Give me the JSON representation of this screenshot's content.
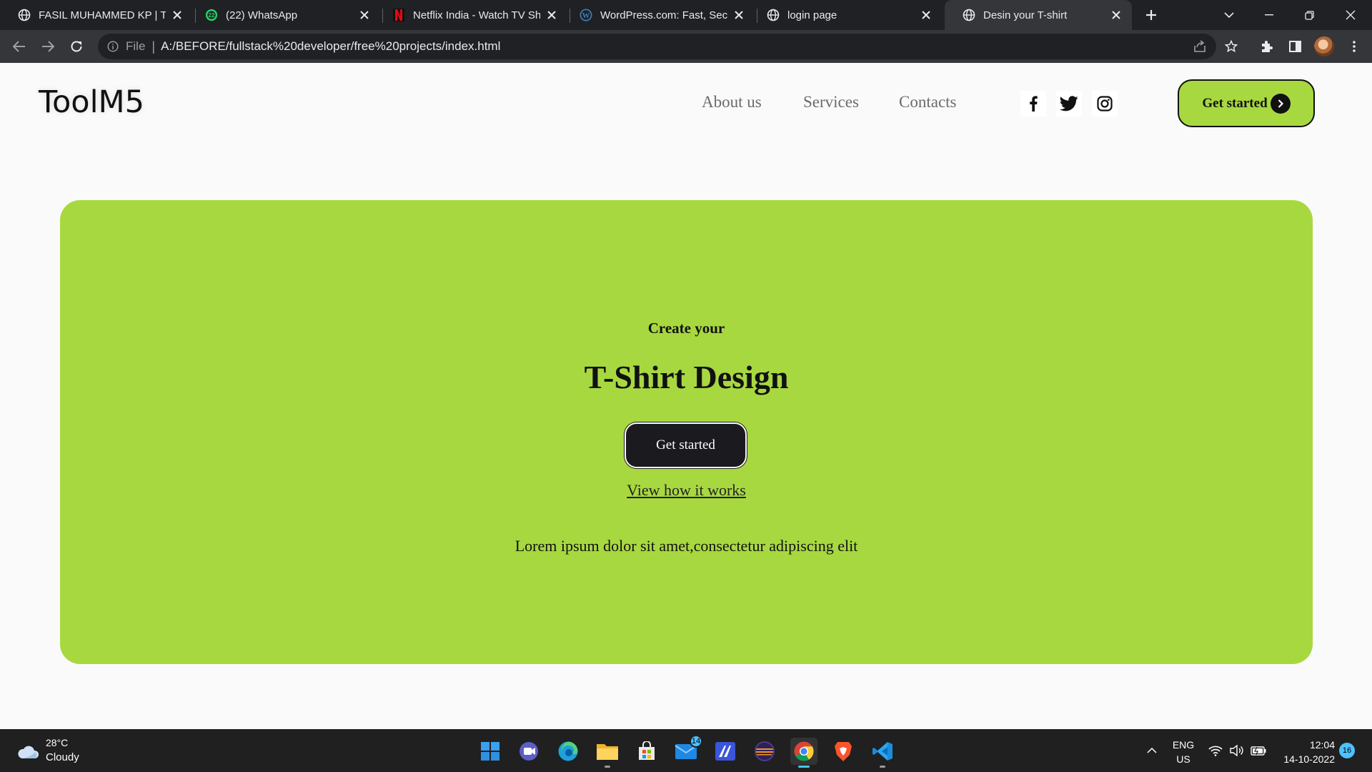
{
  "browser": {
    "tabs": [
      {
        "title": "FASIL MUHAMMED KP | TECH",
        "favicon": "globe-icon"
      },
      {
        "title": "(22) WhatsApp",
        "favicon": "whatsapp-icon",
        "badge": "22"
      },
      {
        "title": "Netflix India - Watch TV Shows",
        "favicon": "netflix-icon"
      },
      {
        "title": "WordPress.com: Fast, Secure",
        "favicon": "wordpress-icon"
      },
      {
        "title": "login page",
        "favicon": "globe-icon"
      },
      {
        "title": "Desin your T-shirt",
        "favicon": "globe-icon",
        "active": true
      }
    ],
    "address": {
      "scheme_label": "File",
      "url": "A:/BEFORE/fullstack%20developer/free%20projects/index.html"
    }
  },
  "site": {
    "logo": "ToolM5",
    "nav": [
      {
        "label": "About us"
      },
      {
        "label": "Services"
      },
      {
        "label": "Contacts"
      }
    ],
    "social": [
      "facebook-icon",
      "twitter-icon",
      "instagram-icon"
    ],
    "cta_label": "Get started",
    "hero": {
      "subtitle": "Create your",
      "title": "T-Shirt Design",
      "button_label": "Get started",
      "link_label": "View how it works",
      "text": "Lorem ipsum dolor sit amet,consectetur adipiscing elit"
    },
    "colors": {
      "accent": "#a8d840",
      "dark": "#1a1a1f",
      "background": "#fafafa"
    }
  },
  "taskbar": {
    "weather": {
      "temp": "28°C",
      "desc": "Cloudy"
    },
    "apps": [
      "windows-start-icon",
      "teams-icon",
      "edge-icon",
      "file-explorer-icon",
      "store-icon",
      "mail-icon",
      "pen-app-icon",
      "eclipse-icon",
      "chrome-icon",
      "brave-icon",
      "vscode-icon"
    ],
    "mail_badge": "14",
    "lang": {
      "line1": "ENG",
      "line2": "US"
    },
    "clock": {
      "time": "12:04",
      "date": "14-10-2022"
    },
    "notifications": "16"
  }
}
